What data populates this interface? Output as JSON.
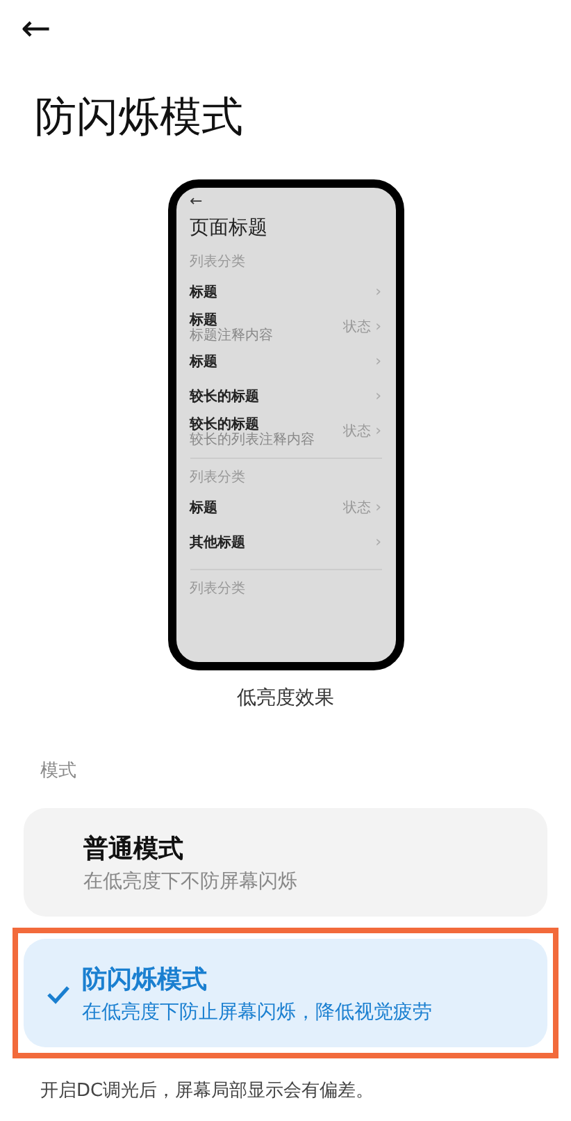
{
  "header": {
    "back": "←",
    "title": "防闪烁模式"
  },
  "preview": {
    "back": "←",
    "title": "页面标题",
    "caption": "低亮度效果",
    "sections": [
      {
        "category": "列表分类",
        "rows": [
          {
            "title": "标题",
            "chevron": "›"
          },
          {
            "title": "标题",
            "subtitle": "标题注释内容",
            "status": "状态",
            "chevron": "›"
          },
          {
            "title": "标题",
            "chevron": "›"
          },
          {
            "title": "较长的标题",
            "chevron": "›"
          },
          {
            "title": "较长的标题",
            "subtitle": "较长的列表注释内容",
            "status": "状态",
            "chevron": "›"
          }
        ]
      },
      {
        "category": "列表分类",
        "rows": [
          {
            "title": "标题",
            "status": "状态",
            "chevron": "›"
          },
          {
            "title": "其他标题",
            "chevron": "›"
          }
        ]
      },
      {
        "category": "列表分类"
      }
    ]
  },
  "section_label": "模式",
  "options": [
    {
      "title": "普通模式",
      "description": "在低亮度下不防屏幕闪烁",
      "selected": false,
      "highlighted": false
    },
    {
      "title": "防闪烁模式",
      "description": "在低亮度下防止屏幕闪烁，降低视觉疲劳",
      "selected": true,
      "highlighted": true
    }
  ],
  "footnote": "开启DC调光后，屏幕局部显示会有偏差。"
}
